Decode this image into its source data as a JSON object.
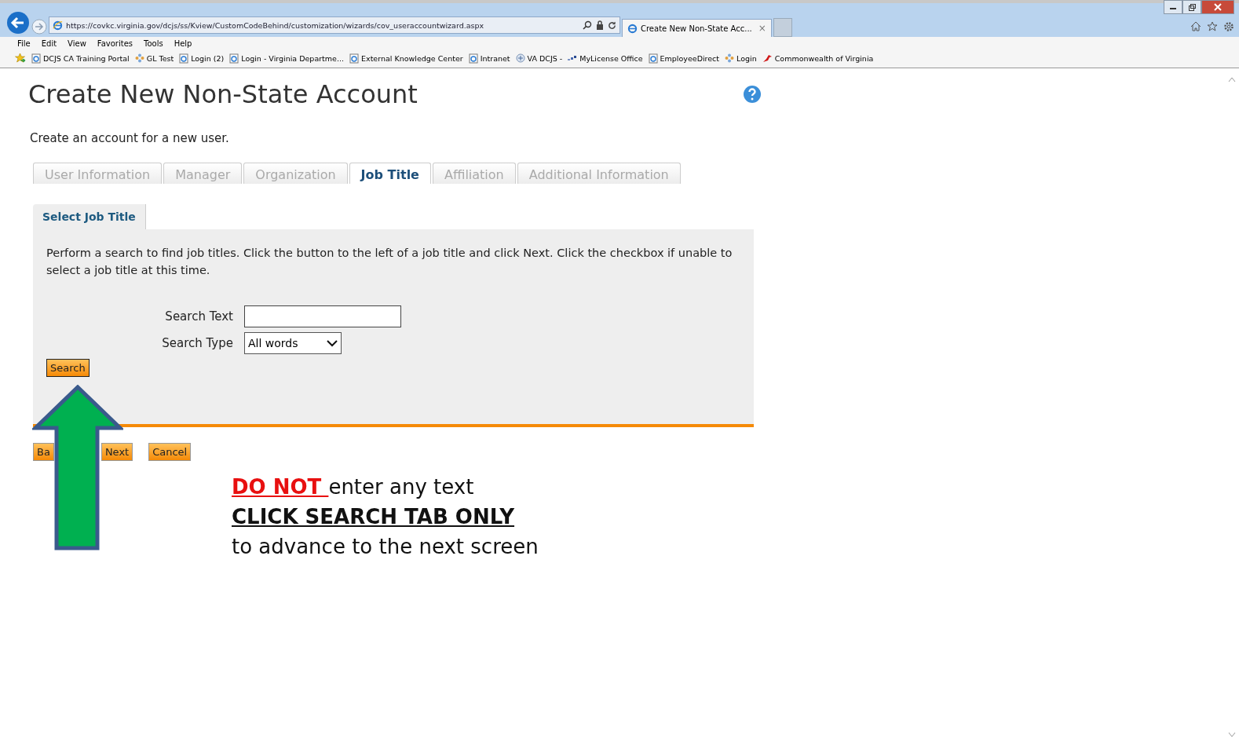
{
  "browser": {
    "url": "https://covkc.virginia.gov/dcjs/ss/Kview/CustomCodeBehind/customization/wizards/cov_useraccountwizard.aspx",
    "tabs": [
      {
        "label": "Create New Non-State Acc...",
        "close": "×",
        "selected": true
      }
    ],
    "menu": [
      "File",
      "Edit",
      "View",
      "Favorites",
      "Tools",
      "Help"
    ],
    "bookmarks": [
      {
        "label": "DCJS CA Training Portal",
        "kind": "page"
      },
      {
        "label": "GL Test",
        "kind": "flower"
      },
      {
        "label": "Login (2)",
        "kind": "page"
      },
      {
        "label": "Login - Virginia Departme...",
        "kind": "page"
      },
      {
        "label": "External Knowledge Center",
        "kind": "page"
      },
      {
        "label": "Intranet",
        "kind": "page"
      },
      {
        "label": "VA DCJS -",
        "kind": "plus"
      },
      {
        "label": "MyLicense Office",
        "kind": "dots"
      },
      {
        "label": "EmployeeDirect",
        "kind": "page"
      },
      {
        "label": "Login",
        "kind": "flower"
      },
      {
        "label": "Commonwealth of Virginia",
        "kind": "bird"
      }
    ]
  },
  "page": {
    "title": "Create New Non-State Account",
    "intro": "Create an account for a new user.",
    "steps": [
      {
        "label": "User Information",
        "selected": false
      },
      {
        "label": "Manager",
        "selected": false
      },
      {
        "label": "Organization",
        "selected": false
      },
      {
        "label": "Job Title",
        "selected": true
      },
      {
        "label": "Affiliation",
        "selected": false
      },
      {
        "label": "Additional Information",
        "selected": false
      }
    ],
    "panel_tab": "Select Job Title",
    "instructions": "Perform a search to find job titles. Click the button to the left of a job title and click Next. Click the checkbox if unable to select a job title at this time.",
    "search_text_label": "Search Text",
    "search_type_label": "Search Type",
    "search_type_value": "All words",
    "search_button": "Search",
    "buttons": [
      "Ba",
      "Next",
      "Cancel"
    ]
  },
  "annotation": {
    "warning": "DO NOT ",
    "warning_rest": "enter any text",
    "action": "CLICK SEARCH TAB ONLY ",
    "note": "to advance to the next screen"
  }
}
